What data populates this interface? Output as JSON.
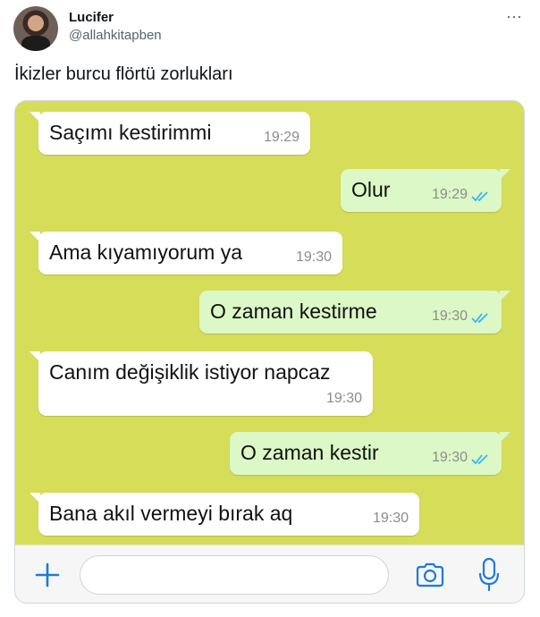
{
  "author": {
    "name": "Lucifer",
    "handle": "@allahkitapben",
    "more_label": "···"
  },
  "tweet": {
    "text": "İkizler burcu flörtü zorlukları"
  },
  "chat": {
    "background_color": "#d6dd59",
    "incoming_color": "#ffffff",
    "outgoing_color": "#dcf8c6",
    "tick_color": "#34b7f1",
    "messages": [
      {
        "direction": "in",
        "text": "Saçımı kestirimmi",
        "time": "19:29"
      },
      {
        "direction": "out",
        "text": "Olur",
        "time": "19:29",
        "status": "read"
      },
      {
        "direction": "in",
        "text": "Ama kıyamıyorum ya",
        "time": "19:30"
      },
      {
        "direction": "out",
        "text": "O zaman kestirme",
        "time": "19:30",
        "status": "read"
      },
      {
        "direction": "in",
        "text": "Canım değişiklik istiyor napcaz",
        "time": "19:30"
      },
      {
        "direction": "out",
        "text": "O zaman kestir",
        "time": "19:30",
        "status": "read"
      },
      {
        "direction": "in",
        "text": "Bana akıl vermeyi bırak aq",
        "time": "19:30"
      }
    ]
  },
  "composer": {
    "input_value": "",
    "accent_color": "#1e7bd9",
    "icons": [
      "plus-icon",
      "camera-icon",
      "microphone-icon"
    ]
  }
}
